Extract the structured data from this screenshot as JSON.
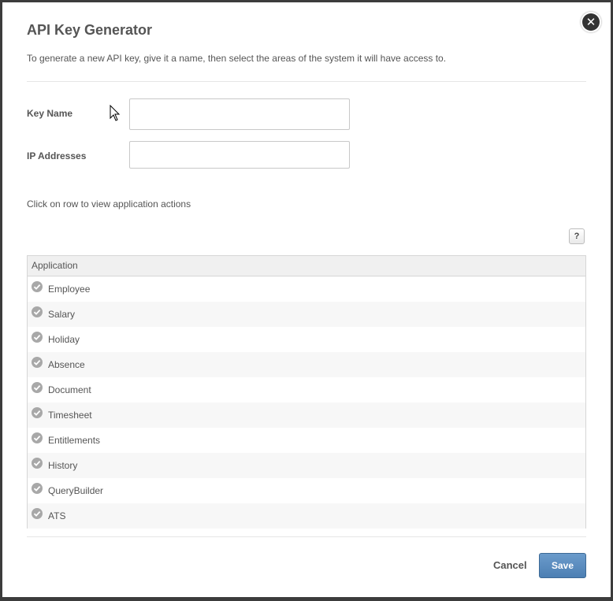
{
  "dialog": {
    "title": "API Key Generator",
    "description": "To generate a new API key, give it a name, then select the areas of the system it will have access to.",
    "close_icon": "close-icon"
  },
  "form": {
    "key_name_label": "Key Name",
    "key_name_value": "",
    "ip_addresses_label": "IP Addresses",
    "ip_addresses_value": ""
  },
  "hint": "Click on row to view application actions",
  "help_button_label": "?",
  "table": {
    "header": "Application",
    "rows": [
      {
        "label": "Employee",
        "checked": true
      },
      {
        "label": "Salary",
        "checked": true
      },
      {
        "label": "Holiday",
        "checked": true
      },
      {
        "label": "Absence",
        "checked": true
      },
      {
        "label": "Document",
        "checked": true
      },
      {
        "label": "Timesheet",
        "checked": true
      },
      {
        "label": "Entitlements",
        "checked": true
      },
      {
        "label": "History",
        "checked": true
      },
      {
        "label": "QueryBuilder",
        "checked": true
      },
      {
        "label": "ATS",
        "checked": true
      }
    ]
  },
  "footer": {
    "cancel_label": "Cancel",
    "save_label": "Save"
  },
  "colors": {
    "save_button": "#5a8bbf",
    "check_icon": "#a8a8a8"
  }
}
